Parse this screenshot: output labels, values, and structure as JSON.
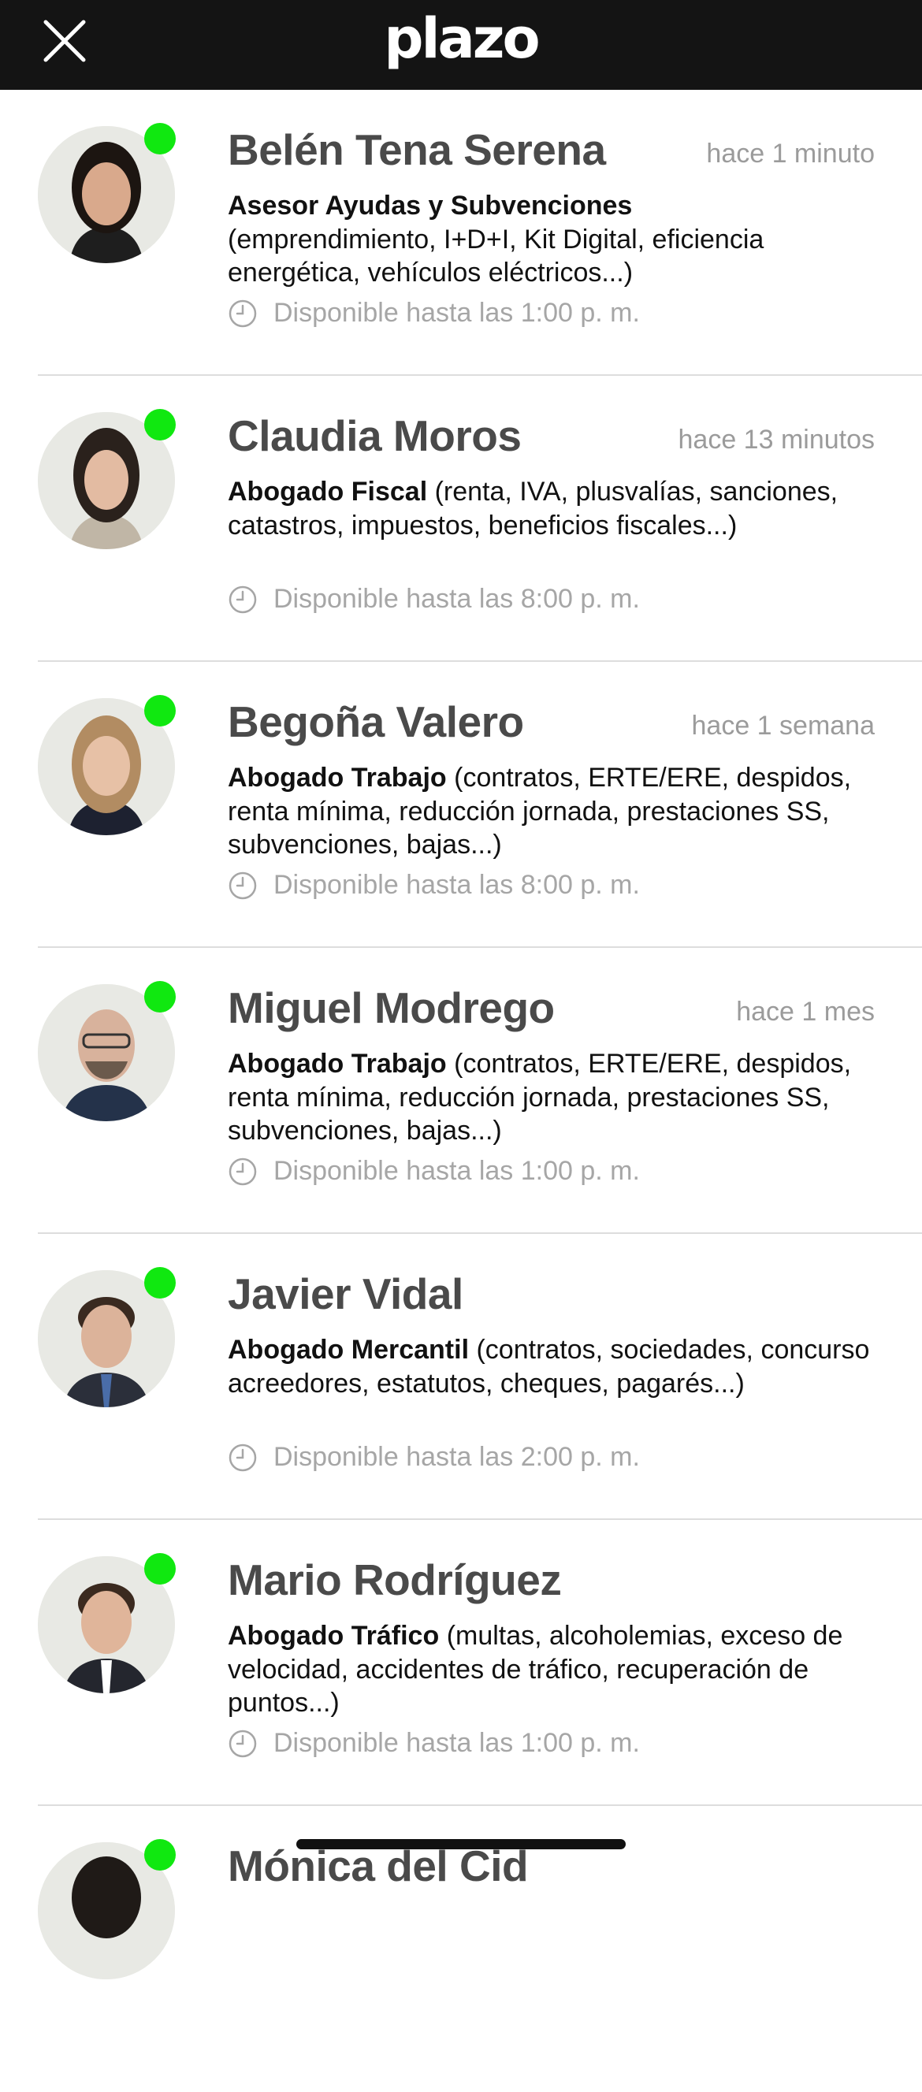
{
  "header": {
    "logo": "plazo",
    "close_icon": "close-icon"
  },
  "colors": {
    "header_bg": "#141414",
    "online_dot": "#10e810",
    "name_text": "#4a4a4a",
    "meta_text": "#9b9b9b"
  },
  "experts": [
    {
      "name": "Belén Tena Serena",
      "time": "hace 1 minuto",
      "role": "Asesor Ayudas y Subvenciones",
      "details": "(emprendimiento, I+D+I, Kit Digital, eficiencia energética, vehículos eléctricos...)",
      "availability": "Disponible hasta las 1:00 p. m."
    },
    {
      "name": "Claudia Moros",
      "time": "hace 13 minutos",
      "role": "Abogado Fiscal",
      "details": "(renta, IVA, plusvalías, sanciones, catastros, impuestos, beneficios fiscales...)",
      "availability": "Disponible hasta las 8:00 p. m."
    },
    {
      "name": "Begoña Valero",
      "time": "hace 1 semana",
      "role": "Abogado Trabajo",
      "details": "(contratos, ERTE/ERE, despidos, renta mínima, reducción jornada, prestaciones SS, subvenciones, bajas...)",
      "availability": "Disponible hasta las 8:00 p. m."
    },
    {
      "name": "Miguel Modrego",
      "time": "hace 1 mes",
      "role": "Abogado Trabajo",
      "details": "(contratos, ERTE/ERE, despidos, renta mínima, reducción jornada, prestaciones SS, subvenciones, bajas...)",
      "availability": "Disponible hasta las 1:00 p. m."
    },
    {
      "name": "Javier Vidal",
      "time": "",
      "role": "Abogado Mercantil",
      "details": "(contratos, sociedades, concurso acreedores, estatutos, cheques, pagarés...)",
      "availability": "Disponible hasta las 2:00 p. m."
    },
    {
      "name": "Mario Rodríguez",
      "time": "",
      "role": "Abogado Tráfico",
      "details": "(multas, alcoholemias, exceso de velocidad, accidentes de tráfico, recuperación de puntos...)",
      "availability": "Disponible hasta las 1:00 p. m."
    },
    {
      "name": "Mónica del Cid"
    }
  ]
}
